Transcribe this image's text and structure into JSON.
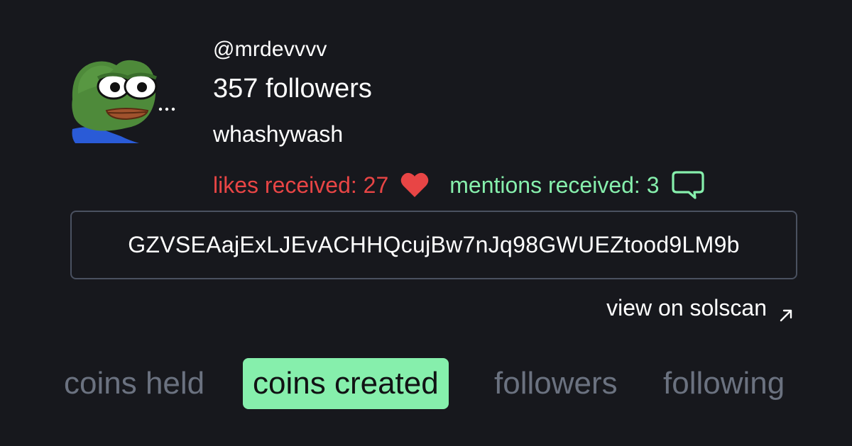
{
  "profile": {
    "handle": "@mrdevvvv",
    "followers": "357 followers",
    "bio": "whashywash",
    "avatar": "pepe-frog-avatar"
  },
  "stats": {
    "likes_label": "likes received: 27",
    "likes_icon": "heart-icon",
    "mentions_label": "mentions received: 3",
    "mentions_icon": "comment-icon"
  },
  "wallet": {
    "address": "GZVSEAajExLJEvACHHQcujBw7nJq98GWUEZtood9LM9b"
  },
  "links": {
    "solscan_label": "view on solscan",
    "solscan_icon": "external-arrow-icon"
  },
  "tabs": [
    {
      "label": "coins held",
      "active": false
    },
    {
      "label": "coins created",
      "active": true
    },
    {
      "label": "followers",
      "active": false
    },
    {
      "label": "following",
      "active": false
    }
  ],
  "colors": {
    "background": "#17181d",
    "likes": "#e84545",
    "mentions": "#86efac",
    "active_tab_bg": "#86efac",
    "inactive_tab_text": "#6b7280",
    "address_border": "#4a5160"
  }
}
